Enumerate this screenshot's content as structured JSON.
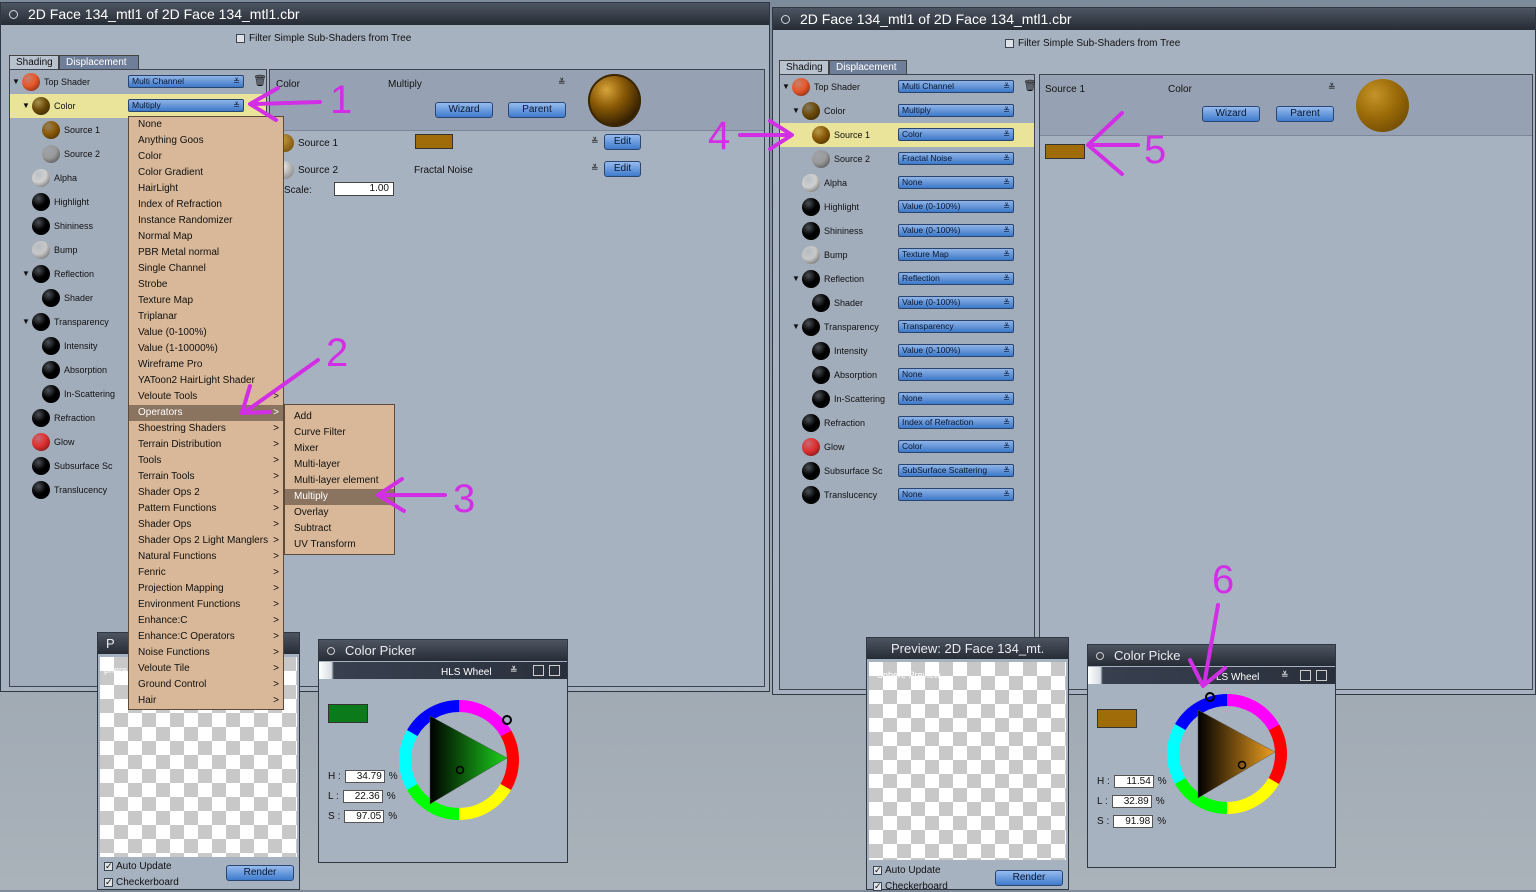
{
  "left_window": {
    "title": "2D Face 134_mtl1 of 2D Face 134_mtl1.cbr",
    "filter_label": "Filter Simple Sub-Shaders from Tree",
    "tabs": [
      "Shading",
      "Displacement"
    ],
    "tree": [
      {
        "label": "Top Shader",
        "value": "Multi Channel",
        "color": "#e8572a"
      },
      {
        "label": "Color",
        "value": "Multiply",
        "color": "#6b4a0a",
        "selected": true
      },
      {
        "label": "Source 1",
        "color": "#8a5a06"
      },
      {
        "label": "Source 2",
        "color": "#9a9a9a"
      },
      {
        "label": "Alpha",
        "color": "#d0d0d0"
      },
      {
        "label": "Highlight",
        "color": "#000000"
      },
      {
        "label": "Shininess",
        "color": "#000000"
      },
      {
        "label": "Bump",
        "color": "#c8c8c8"
      },
      {
        "label": "Reflection",
        "color": "#000000"
      },
      {
        "label": "Shader",
        "color": "#000000"
      },
      {
        "label": "Transparency",
        "color": "#000000"
      },
      {
        "label": "Intensity",
        "color": "#000000"
      },
      {
        "label": "Absorption",
        "color": "#000000"
      },
      {
        "label": "In-Scattering",
        "color": "#000000"
      },
      {
        "label": "Refraction",
        "color": "#000000"
      },
      {
        "label": "Glow",
        "color": "#e03030"
      },
      {
        "label": "Subsurface Sc",
        "color": "#000000"
      },
      {
        "label": "Translucency",
        "color": "#000000"
      }
    ],
    "detail": {
      "header_label": "Color",
      "header_value": "Multiply",
      "wizard": "Wizard",
      "parent": "Parent",
      "source1": "Source 1",
      "source2": "Source 2",
      "source2_value": "Fractal Noise",
      "edit": "Edit",
      "scale_label": "Scale:",
      "scale_value": "1.00",
      "swatch_color": "#a06c0a"
    },
    "menu": [
      "None",
      "Anything Goos",
      "Color",
      "Color Gradient",
      "HairLight",
      "Index of Refraction",
      "Instance Randomizer",
      "Normal Map",
      "PBR Metal normal",
      "Single Channel",
      "Strobe",
      "Texture Map",
      "Triplanar",
      "Value (0-100%)",
      "Value (1-10000%)",
      "Wireframe Pro",
      "YAToon2 HairLight Shader",
      "Veloute Tools",
      "Operators",
      "Shoestring Shaders",
      "Terrain Distribution",
      "Tools",
      "Terrain Tools",
      "Shader Ops 2",
      "Pattern Functions",
      "Shader Ops",
      "Shader Ops 2 Light Manglers",
      "Natural Functions",
      "Fenric",
      "Projection Mapping",
      "Environment Functions",
      "Enhance:C",
      "Enhance:C Operators",
      "Noise Functions",
      "Veloute Tile",
      "Ground Control",
      "Hair"
    ],
    "menu_arrows_from": 17,
    "menu_highlight": "Operators",
    "submenu": [
      "Add",
      "Curve Filter",
      "Mixer",
      "Multi-layer",
      "Multi-layer element",
      "Multiply",
      "Overlay",
      "Subtract",
      "UV Transform"
    ],
    "submenu_highlight": "Multiply"
  },
  "left_preview": {
    "title_fragment": "P",
    "checkbox1": "Auto Update",
    "checkbox2": "Checkerboard",
    "render": "Render",
    "faint_label": "phere"
  },
  "left_picker": {
    "title": "Color Picker",
    "mode": "HLS Wheel",
    "H": "34.79",
    "L": "22.36",
    "S": "97.05",
    "swatch": "#0a7a1a",
    "pct": "%"
  },
  "right_window": {
    "title": "2D Face 134_mtl1 of 2D Face 134_mtl1.cbr",
    "filter_label": "Filter Simple Sub-Shaders from Tree",
    "tabs": [
      "Shading",
      "Displacement"
    ],
    "tree": [
      {
        "label": "Top Shader",
        "value": "Multi Channel",
        "color": "#e8572a"
      },
      {
        "label": "Color",
        "value": "Multiply",
        "color": "#6b4a0a"
      },
      {
        "label": "Source 1",
        "value": "Color",
        "color": "#8a5a06",
        "selected": true
      },
      {
        "label": "Source 2",
        "value": "Fractal Noise",
        "color": "#9a9a9a"
      },
      {
        "label": "Alpha",
        "value": "None",
        "color": "#d0d0d0"
      },
      {
        "label": "Highlight",
        "value": "Value (0-100%)",
        "color": "#000000"
      },
      {
        "label": "Shininess",
        "value": "Value (0-100%)",
        "color": "#000000"
      },
      {
        "label": "Bump",
        "value": "Texture Map",
        "color": "#c8c8c8"
      },
      {
        "label": "Reflection",
        "value": "Reflection",
        "color": "#000000"
      },
      {
        "label": "Shader",
        "value": "Value (0-100%)",
        "color": "#000000"
      },
      {
        "label": "Transparency",
        "value": "Transparency",
        "color": "#000000"
      },
      {
        "label": "Intensity",
        "value": "Value (0-100%)",
        "color": "#000000"
      },
      {
        "label": "Absorption",
        "value": "None",
        "color": "#000000"
      },
      {
        "label": "In-Scattering",
        "value": "None",
        "color": "#000000"
      },
      {
        "label": "Refraction",
        "value": "Index of Refraction",
        "color": "#000000"
      },
      {
        "label": "Glow",
        "value": "Color",
        "color": "#e03030"
      },
      {
        "label": "Subsurface Sc",
        "value": "SubSurface Scattering",
        "color": "#000000"
      },
      {
        "label": "Translucency",
        "value": "None",
        "color": "#000000"
      }
    ],
    "detail": {
      "header_label": "Source 1",
      "header_value": "Color",
      "wizard": "Wizard",
      "parent": "Parent",
      "swatch_color": "#a06c0a"
    }
  },
  "right_preview": {
    "title": "Preview: 2D Face 134_mt.",
    "checkbox1": "Auto Update",
    "checkbox2": "Checkerboard",
    "render": "Render",
    "faint_label": "Sphere Preview"
  },
  "right_picker": {
    "title": "Color Picke",
    "mode": "LS Wheel",
    "H": "11.54",
    "L": "32.89",
    "S": "91.98",
    "swatch": "#a06c0a",
    "pct": "%"
  },
  "annotations": [
    "1",
    "2",
    "3",
    "4",
    "5",
    "6"
  ],
  "colors": {
    "annotation": "#d22ee6",
    "menu_bg": "#d8b898",
    "selected_row": "#e9e49a"
  }
}
